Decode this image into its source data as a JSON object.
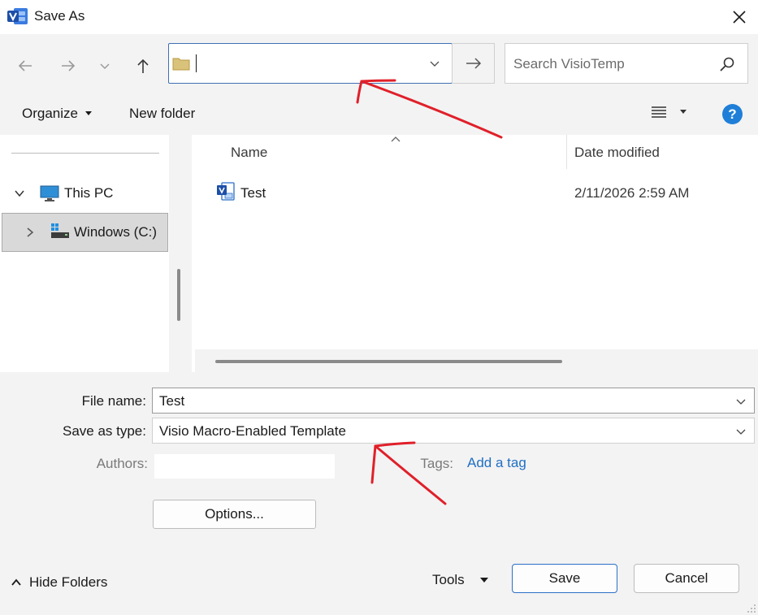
{
  "window": {
    "title": "Save As",
    "app_icon": "visio-app-icon"
  },
  "navigation": {
    "address_value": "",
    "search_placeholder": "Search VisioTemp"
  },
  "command_bar": {
    "organize_label": "Organize",
    "new_folder_label": "New folder"
  },
  "nav_pane": {
    "items": [
      {
        "label": "This PC",
        "icon": "pc-monitor-icon",
        "expanded": true
      },
      {
        "label": "Windows (C:)",
        "icon": "drive-icon",
        "expanded": false,
        "selected": true
      }
    ]
  },
  "file_list": {
    "columns": [
      "Name",
      "Date modified"
    ],
    "rows": [
      {
        "name": "Test",
        "date_modified": "2/11/2026 2:59 AM",
        "icon": "visio-file-icon"
      }
    ]
  },
  "details": {
    "file_name_label": "File name:",
    "file_name_value": "Test",
    "save_type_label": "Save as type:",
    "save_type_value": "Visio Macro-Enabled Template",
    "authors_label": "Authors:",
    "tags_label": "Tags:",
    "tags_link": "Add a tag",
    "options_label": "Options..."
  },
  "footer": {
    "hide_folders_label": "Hide Folders",
    "tools_label": "Tools",
    "save_label": "Save",
    "cancel_label": "Cancel"
  },
  "colors": {
    "accent": "#2b6fc9",
    "help": "#1f7fd8",
    "link": "#1f6fc4",
    "annotation": "#e0202a",
    "chrome_bg": "#f3f3f3"
  }
}
